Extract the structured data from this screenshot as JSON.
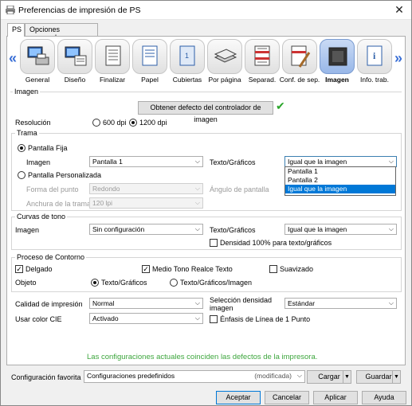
{
  "window": {
    "title": "Preferencias de impresión de PS",
    "close_glyph": "✕"
  },
  "tabs": [
    {
      "label": "PS",
      "active": true
    },
    {
      "label": "Opciones avanzadas",
      "active": false
    }
  ],
  "icon_bar": {
    "prev_arrow": "«",
    "next_arrow": "»",
    "items": [
      {
        "label": "General",
        "icon": "computer-printer-icon"
      },
      {
        "label": "Diseño",
        "icon": "layout-icon"
      },
      {
        "label": "Finalizar",
        "icon": "finishing-icon"
      },
      {
        "label": "Papel",
        "icon": "paper-icon"
      },
      {
        "label": "Cubiertas",
        "icon": "covers-icon"
      },
      {
        "label": "Por página",
        "icon": "per-page-icon"
      },
      {
        "label": "Separad.",
        "icon": "separator-icon"
      },
      {
        "label": "Conf. de sep.",
        "icon": "separator-settings-icon"
      },
      {
        "label": "Imagen",
        "icon": "image-icon",
        "active": true
      },
      {
        "label": "Info. trab.",
        "icon": "job-info-icon"
      }
    ]
  },
  "imagen": {
    "section_title": "Imagen",
    "get_defaults_button": "Obtener defecto del controlador de imagen",
    "check_icon": "✔",
    "resolution_label": "Resolución",
    "res_600": "600 dpi",
    "res_1200": "1200 dpi"
  },
  "trama": {
    "title": "Trama",
    "fija_label": "Pantalla Fija",
    "imagen_label": "Imagen",
    "imagen_value": "Pantalla 1",
    "texto_label": "Texto/Gráficos",
    "texto_value": "Igual que la imagen",
    "dropdown_options": [
      "Pantalla 1",
      "Pantalla 2",
      "Igual que la imagen"
    ],
    "personalizada_label": "Pantalla Personalizada",
    "forma_label": "Forma del punto",
    "forma_value": "Redondo",
    "angulo_label": "Ángulo de pantalla",
    "anchura_label": "Anchura de la trama",
    "anchura_value": "120 lpi"
  },
  "curvas": {
    "title": "Curvas de tono",
    "imagen_label": "Imagen",
    "imagen_value": "Sin configuración",
    "texto_label": "Texto/Gráficos",
    "texto_value": "Igual que la imagen",
    "densidad_label": "Densidad 100% para texto/gráficos"
  },
  "contorno": {
    "title": "Proceso de Contorno",
    "delgado_label": "Delgado",
    "medio_tono_label": "Medio Tono Realce Texto",
    "suavizado_label": "Suavizado",
    "objeto_label": "Objeto",
    "obj_texto": "Texto/Gráficos",
    "obj_texto_imagen": "Texto/Gráficos/Imagen"
  },
  "calidad": {
    "label": "Calidad de impresión",
    "value": "Normal",
    "densidad_sel_label": "Selección densidad imagen",
    "densidad_sel_value": "Estándar",
    "cie_label": "Usar color CIE",
    "cie_value": "Activado",
    "enfasis_label": "Énfasis de Línea de 1 Punto"
  },
  "status_message": "Las configuraciones actuales coinciden las defectos de la impresora.",
  "favoritos": {
    "label": "Configuración favorita",
    "value": "Configuraciones predefinidos",
    "modified": "(modificada)",
    "load_button": "Cargar",
    "save_button": "Guardar"
  },
  "footer": {
    "accept": "Aceptar",
    "cancel": "Cancelar",
    "apply": "Aplicar",
    "help": "Ayuda"
  },
  "colors": {
    "accent": "#0078d7",
    "status_green": "#3da63d",
    "nav_arrow": "#3a6fd6"
  }
}
